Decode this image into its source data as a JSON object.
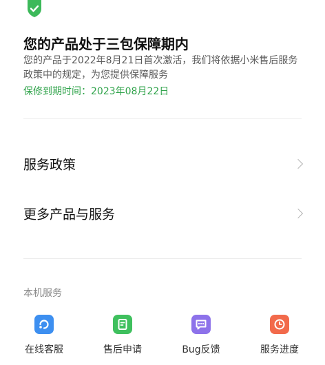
{
  "warranty": {
    "icon": "shield-check-icon",
    "title": "您的产品处于三包保障期内",
    "description": "您的产品于2022年8月21日首次激活，我们将依据小米售后服务政策中的规定，为您提供保障服务",
    "expiry": "保修到期时间：2023年08月22日",
    "status_color": "#2fa34a"
  },
  "menu": [
    {
      "label": "服务政策",
      "icon": "chevron-right-icon"
    },
    {
      "label": "更多产品与服务",
      "icon": "chevron-right-icon"
    }
  ],
  "device_services": {
    "title": "本机服务",
    "items": [
      {
        "label": "在线客服",
        "icon": "headset-icon",
        "color": "#3d8ff0"
      },
      {
        "label": "售后申请",
        "icon": "document-icon",
        "color": "#3fc05e"
      },
      {
        "label": "Bug反馈",
        "icon": "chat-bubble-icon",
        "color": "#8d72ea"
      },
      {
        "label": "服务进度",
        "icon": "clock-icon",
        "color": "#f26a4b"
      }
    ]
  }
}
